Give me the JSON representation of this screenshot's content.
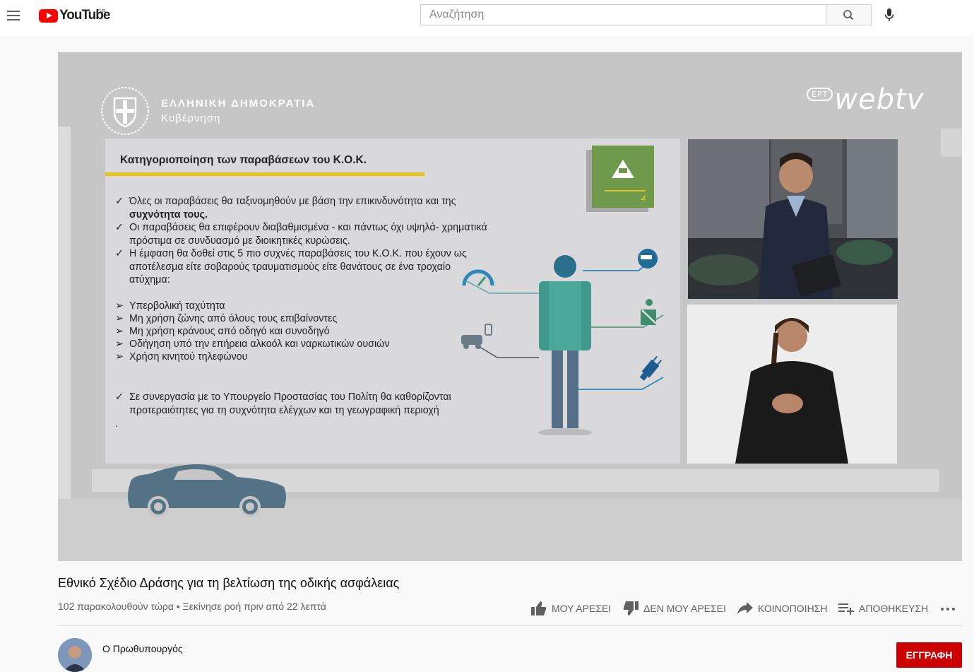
{
  "header": {
    "logo_text": "YouTube",
    "country_code": "GR",
    "search_placeholder": "Αναζήτηση"
  },
  "player": {
    "gov_title": "ΕΛΛΗΝΙΚΗ ΔΗΜΟΚΡΑΤΙΑ",
    "gov_subtitle": "Κυβέρνηση",
    "broadcaster_badge": "ΕΡΤ",
    "broadcaster": "webtv",
    "slide": {
      "title": "Κατηγοριοποίηση των παραβάσεων του Κ.Ο.Κ.",
      "badge_number": "4",
      "check_1_line_1": "Όλες οι παραβάσεις θα ταξινομηθούν με βάση την επικινδυνότητα και της",
      "check_1_line_2": "συχνότητα τους.",
      "check_2_line_1": "Οι παραβάσεις θα επιφέρουν διαβαθμισμένα - και πάντως όχι υψηλά-  χρηματικά",
      "check_2_line_2": "πρόστιμα σε συνδυασμό με διοικητικές κυρώσεις.",
      "check_3_line_1": "Η έμφαση θα δοθεί στις 5 πιο συχνές παραβάσεις του Κ.Ο.Κ. που έχουν ως",
      "check_3_line_2": "αποτέλεσμα είτε σοβαρούς τραυματισμούς είτε θανάτους σε ένα τροχαίο",
      "check_3_line_3": "ατύχημα:",
      "arrow_1": "Υπερβολική ταχύτητα",
      "arrow_2": "Μη χρήση ζώνης από όλους τους επιβαίνοντες",
      "arrow_3": "Μη χρήση κράνους από οδηγό και συνοδηγό",
      "arrow_4": "Οδήγηση υπό την επήρεια αλκοόλ και ναρκωτικών ουσιών",
      "arrow_5": "Χρήση κινητού τηλεφώνου",
      "check_4_line_1": "Σε συνεργασία με το Υπουργείο Προστασίας του Πολίτη θα καθορίζονται",
      "check_4_line_2": "προτεραιότητες για τη συχνότητα ελέγχων και τη γεωγραφική περιοχή",
      "dot": ".",
      "check_mark": "✓",
      "arrow_mark": "➢"
    }
  },
  "video": {
    "title": "Εθνικό Σχέδιο Δράσης για τη βελτίωση της οδικής ασφάλειας",
    "meta": "102 παρακολουθούν τώρα • Ξεκίνησε ροή πριν από 22 λεπτά"
  },
  "actions": {
    "like": "ΜΟΥ ΑΡΕΣΕΙ",
    "dislike": "ΔΕΝ ΜΟΥ ΑΡΕΣΕΙ",
    "share": "ΚΟΙΝΟΠΟΙΗΣΗ",
    "save": "ΑΠΟΘΗΚΕΥΣΗ"
  },
  "channel": {
    "name": "Ο Πρωθυπουργός",
    "subscribe": "ΕΓΓΡΑΦΗ"
  },
  "colors": {
    "brand_red": "#ff0000",
    "subscribe_red": "#cc0000",
    "slide_accent": "#e6c21a",
    "badge_green": "#6f9a4b"
  }
}
